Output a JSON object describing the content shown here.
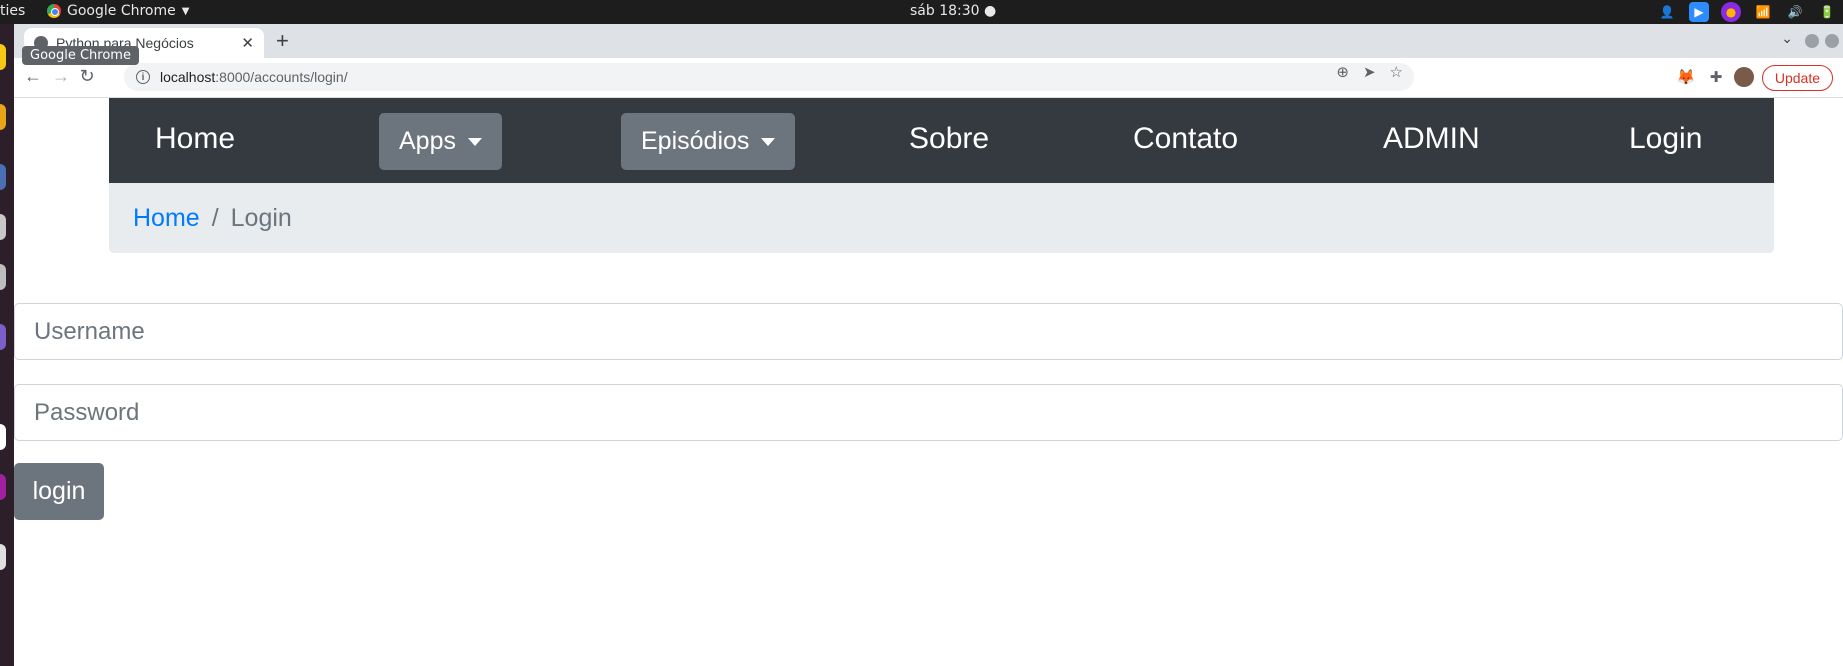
{
  "topbar": {
    "activities": "ties",
    "app_name": "Google Chrome",
    "clock": "sáb 18:30 ●"
  },
  "browser": {
    "tab_title": "Python para Negócios",
    "tooltip": "Google Chrome",
    "url_host": "localhost",
    "url_path": ":8000/accounts/login/",
    "update_label": "Update"
  },
  "navbar": {
    "home": "Home",
    "apps": "Apps",
    "episodios": "Episódios",
    "sobre": "Sobre",
    "contato": "Contato",
    "admin": "ADMIN",
    "login": "Login"
  },
  "breadcrumb": {
    "home": "Home",
    "separator": "/",
    "current": "Login"
  },
  "form": {
    "username_placeholder": "Username",
    "password_placeholder": "Password",
    "submit_label": "login"
  },
  "colors": {
    "navbar_bg": "#343a40",
    "dropdown_bg": "#6c757d",
    "breadcrumb_bg": "#e9ecef",
    "link": "#007bff",
    "update": "#d93025"
  }
}
